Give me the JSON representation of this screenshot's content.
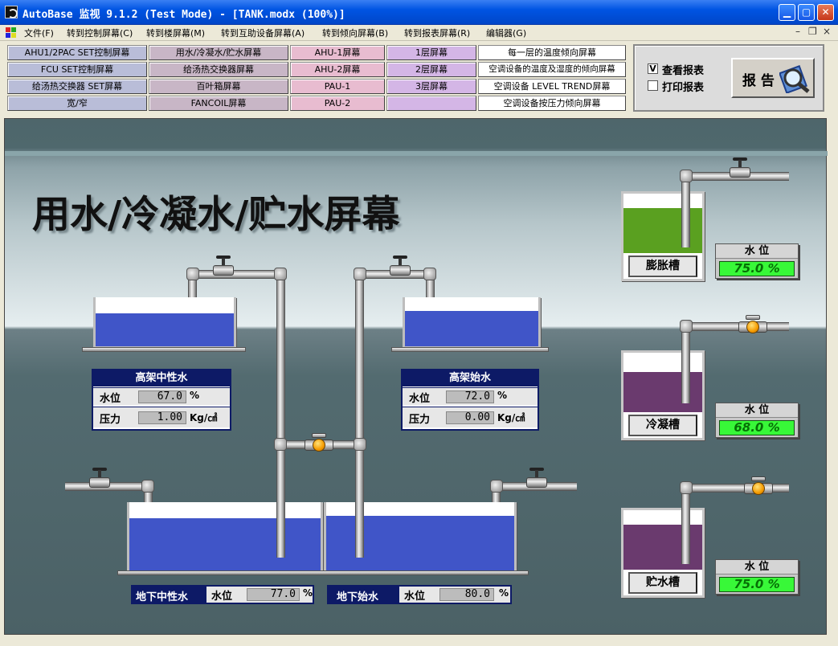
{
  "window": {
    "title": "AutoBase 监视 9.1.2 (Test Mode) - [TANK.modx (100%)]"
  },
  "menu": [
    "文件(F)",
    "转到控制屏幕(C)",
    "转到楼屏幕(M)",
    "转到互助设备屏幕(A)",
    "转到倾向屏幕(B)",
    "转到报表屏幕(R)",
    "编辑器(G)"
  ],
  "nav": {
    "col1": [
      "AHU1/2PAC SET控制屏幕",
      "FCU SET控制屏幕",
      "给汤热交换器 SET屏幕",
      "宽/窄"
    ],
    "col2": [
      "用水/冷凝水/贮水屏幕",
      "给汤热交换器屏幕",
      "百叶箱屏幕",
      "FANCOIL屏幕"
    ],
    "col3": [
      "AHU-1屏幕",
      "AHU-2屏幕",
      "PAU-1",
      "PAU-2"
    ],
    "col4": [
      "1层屏幕",
      "2层屏幕",
      "3层屏幕",
      ""
    ],
    "col5": [
      "每一层的温度倾向屏幕",
      "空调设备的温度及湿度的倾向屏幕",
      "空调设备 LEVEL TREND屏幕",
      "空调设备按压力倾向屏幕"
    ]
  },
  "report": {
    "view_label": "查看报表",
    "view_checked": "V",
    "print_label": "打印报表",
    "button_label": "报 告"
  },
  "screen": {
    "title": "用水/冷凝水/贮水屏幕"
  },
  "elevated_neutral": {
    "title": "高架中性水",
    "level_label": "水位",
    "level_value": "67.0",
    "level_unit": "%",
    "pressure_label": "压力",
    "pressure_value": "1.00",
    "pressure_unit": "Kg/㎠",
    "level_fraction": 0.67
  },
  "elevated_start": {
    "title": "高架始水",
    "level_label": "水位",
    "level_value": "72.0",
    "level_unit": "%",
    "pressure_label": "压力",
    "pressure_value": "0.00",
    "pressure_unit": "Kg/㎠",
    "level_fraction": 0.72
  },
  "underground_neutral": {
    "title": "地下中性水",
    "level_label": "水位",
    "level_value": "77.0",
    "level_unit": "%",
    "level_fraction": 0.77
  },
  "underground_start": {
    "title": "地下始水",
    "level_label": "水位",
    "level_value": "80.0",
    "level_unit": "%",
    "level_fraction": 0.8
  },
  "expansion_tank": {
    "name": "膨胀槽",
    "level_title": "水 位",
    "level_value": "75.0 %",
    "level_fraction": 0.75,
    "color": "#5aa020"
  },
  "condensate_tank": {
    "name": "冷凝槽",
    "level_title": "水 位",
    "level_value": "68.0 %",
    "level_fraction": 0.68,
    "color": "#6a3a6e"
  },
  "storage_tank": {
    "name": "贮水槽",
    "level_title": "水 位",
    "level_value": "75.0 %",
    "level_fraction": 0.75,
    "color": "#6a3a6e"
  },
  "colors": {
    "water": "#4055c8",
    "nav_col1": "#b9bdd8",
    "nav_col2": "#c8b6c6",
    "nav_col3": "#e8bcd0",
    "nav_col4": "#d4b6e6",
    "nav_col5": "#ffffff"
  }
}
